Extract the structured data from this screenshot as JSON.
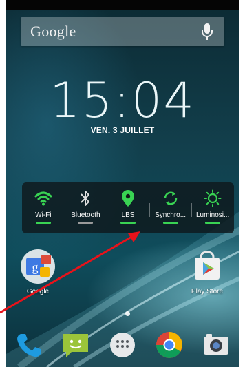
{
  "search": {
    "logo": "Google"
  },
  "clock": {
    "time": "15:04",
    "date": "VEN. 3 JUILLET"
  },
  "quick_settings": [
    {
      "label": "Wi-Fi",
      "icon": "wifi-icon",
      "active": true
    },
    {
      "label": "Bluetooth",
      "icon": "bluetooth-icon",
      "active": false
    },
    {
      "label": "LBS",
      "icon": "location-icon",
      "active": true
    },
    {
      "label": "Synchro...",
      "icon": "sync-icon",
      "active": true
    },
    {
      "label": "Luminosi...",
      "icon": "brightness-icon",
      "active": true
    }
  ],
  "desktop": [
    {
      "label": "Google",
      "icon": "google-folder-icon"
    },
    {
      "label": "Play Store",
      "icon": "play-store-icon"
    }
  ],
  "dock": [
    {
      "icon": "phone-icon"
    },
    {
      "icon": "messaging-icon"
    },
    {
      "icon": "app-drawer-icon"
    },
    {
      "icon": "chrome-icon"
    },
    {
      "icon": "camera-icon"
    }
  ],
  "colors": {
    "accent_green": "#39d353",
    "indicator_off": "#9a9a9a",
    "arrow_red": "#e8121a"
  }
}
